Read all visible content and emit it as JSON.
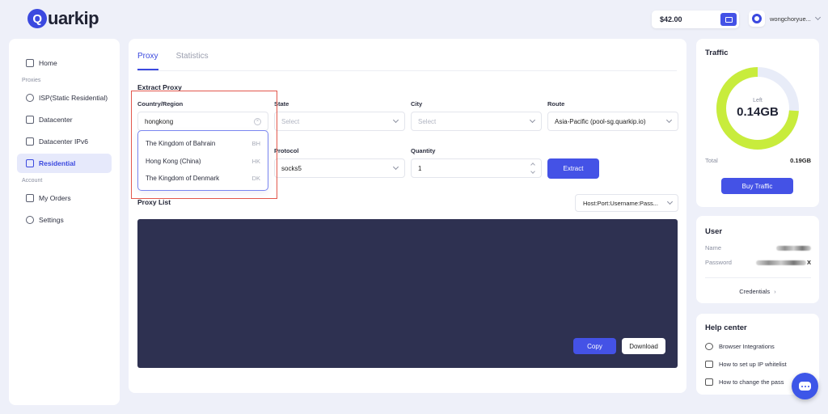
{
  "header": {
    "logo_text": "uarkip",
    "logo_letter": "Q",
    "balance": "$42.00",
    "username": "wongchoryue..."
  },
  "sidebar": {
    "home": "Home",
    "proxies_label": "Proxies",
    "items": [
      "ISP(Static Residential)",
      "Datacenter",
      "Datacenter IPv6",
      "Residential"
    ],
    "account_label": "Account",
    "account_items": [
      "My Orders",
      "Settings"
    ]
  },
  "main": {
    "tabs": [
      "Proxy",
      "Statistics"
    ],
    "extract_title": "Extract Proxy",
    "country_label": "Country/Region",
    "country_value": "hongkong",
    "state_label": "State",
    "state_placeholder": "Select",
    "city_label": "City",
    "city_placeholder": "Select",
    "route_label": "Route",
    "route_value": "Asia-Pacific (pool-sg.quarkip.io)",
    "protocol_label": "Protocol",
    "protocol_value": "socks5",
    "quantity_label": "Quantity",
    "quantity_value": "1",
    "extract_button": "Extract",
    "dropdown_options": [
      {
        "name": "The Kingdom of Bahrain",
        "code": "BH"
      },
      {
        "name": "Hong Kong (China)",
        "code": "HK"
      },
      {
        "name": "The Kingdom of Denmark",
        "code": "DK"
      }
    ],
    "proxy_list_title": "Proxy List",
    "format_value": "Host:Port:Username:Pass...",
    "copy_button": "Copy",
    "download_button": "Download"
  },
  "traffic": {
    "title": "Traffic",
    "left_label": "Left",
    "left_value": "0.14GB",
    "total_label": "Total",
    "total_value": "0.19GB",
    "used_fraction": 0.26,
    "buy_button": "Buy Traffic",
    "accent": "#c8ec3c",
    "remaining_track": "#e8ecf8"
  },
  "user": {
    "title": "User",
    "name_label": "Name",
    "password_label": "Password",
    "password_tail": "X",
    "credentials_link": "Credentials"
  },
  "help": {
    "title": "Help center",
    "items": [
      "Browser Integrations",
      "How to set up IP whitelist",
      "How to change the pass"
    ]
  }
}
